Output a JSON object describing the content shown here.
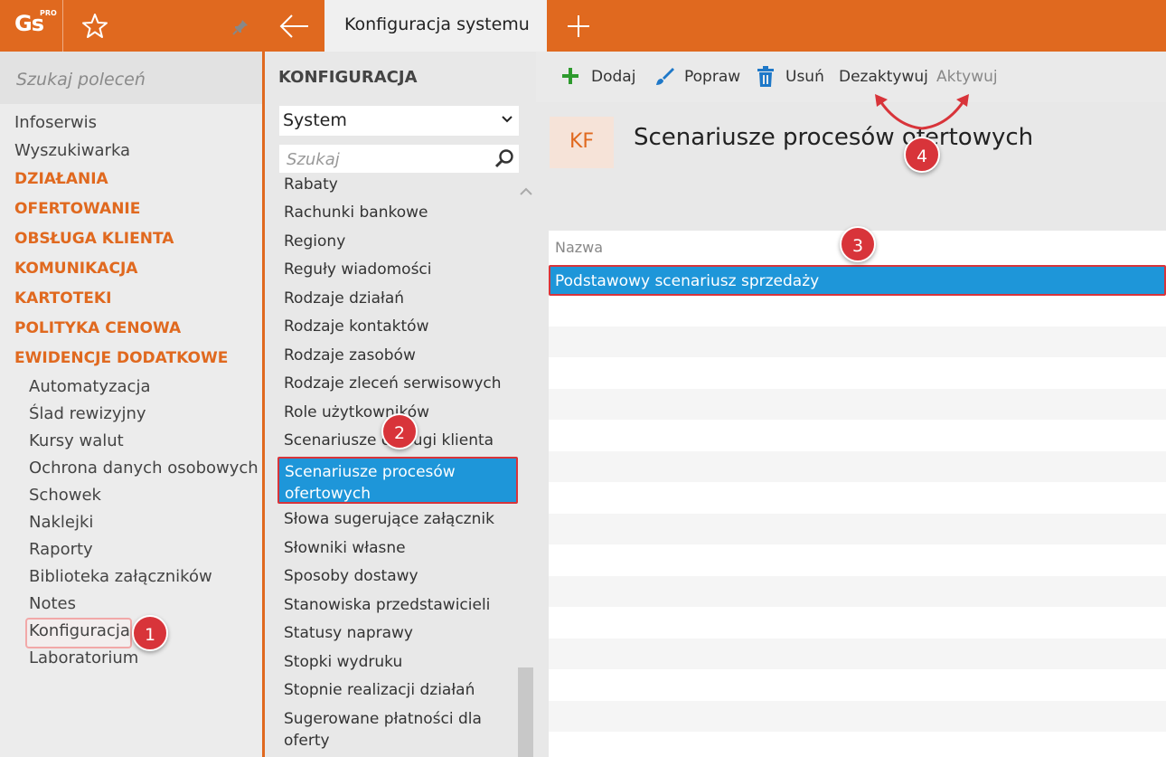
{
  "app": {
    "logo_text": "Gs",
    "logo_sup": "PRO"
  },
  "header": {
    "tab_title": "Konfiguracja systemu"
  },
  "left": {
    "search_placeholder": "Szukaj poleceń",
    "top_items": [
      "Infoserwis",
      "Wyszukiwarka"
    ],
    "categories": [
      "DZIAŁANIA",
      "OFERTOWANIE",
      "OBSŁUGA KLIENTA",
      "KOMUNIKACJA",
      "KARTOTEKI",
      "POLITYKA CENOWA",
      "EWIDENCJE DODATKOWE"
    ],
    "sub_items": [
      "Automatyzacja",
      "Ślad rewizyjny",
      "Kursy walut",
      "Ochrona danych osobowych",
      "Schowek",
      "Naklejki",
      "Raporty",
      "Biblioteka załączników",
      "Notes",
      "Konfiguracja",
      "Laboratorium"
    ]
  },
  "middle": {
    "title": "KONFIGURACJA",
    "select_value": "System",
    "search_placeholder": "Szukaj",
    "items": [
      "Rabaty",
      "Rachunki bankowe",
      "Regiony",
      "Reguły wiadomości",
      "Rodzaje działań",
      "Rodzaje kontaktów",
      "Rodzaje zasobów",
      "Rodzaje zleceń serwisowych",
      "Role użytkowników",
      "Scenariusze obsługi klienta"
    ],
    "selected_line1": "Scenariusze procesów",
    "selected_line2": "ofertowych",
    "items_after": [
      "Słowa sugerujące załącznik",
      "Słowniki własne",
      "Sposoby dostawy",
      "Stanowiska przedstawicieli",
      "Statusy naprawy",
      "Stopki wydruku",
      "Stopnie realizacji działań",
      "Sugerowane płatności dla"
    ],
    "last_item_line2": "oferty"
  },
  "toolbar": {
    "add": "Dodaj",
    "edit": "Popraw",
    "delete": "Usuń",
    "deactivate": "Dezaktywuj",
    "activate": "Aktywuj"
  },
  "page": {
    "badge": "KF",
    "title": "Scenariusze procesów ofertowych",
    "column_header": "Nazwa",
    "rows": [
      "Podstawowy scenariusz sprzedaży"
    ]
  },
  "annotations": [
    "1",
    "2",
    "3",
    "4"
  ],
  "colors": {
    "accent": "#e0691f",
    "selection": "#1e96d9",
    "highlight": "#d8343a"
  }
}
